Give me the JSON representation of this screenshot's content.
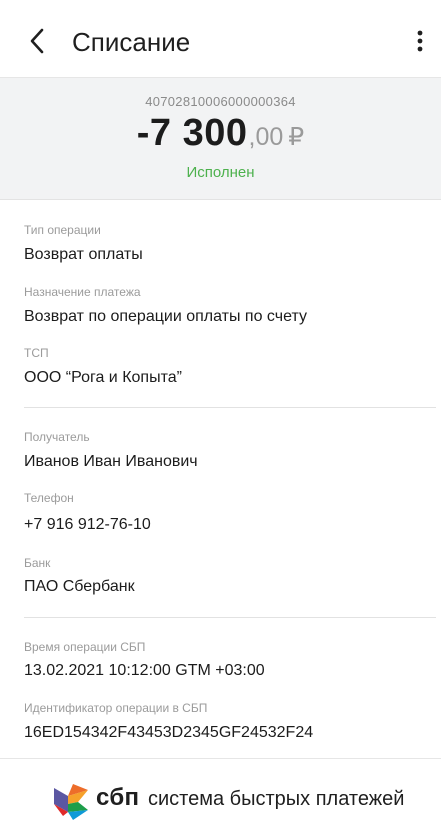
{
  "appbar": {
    "title": "Списание",
    "back_icon": "chevron-left-icon",
    "menu_icon": "more-vertical-icon"
  },
  "summary": {
    "account_number": "40702810006000000364",
    "amount_integer": "-7 300",
    "amount_fraction": ",00",
    "currency": "₽",
    "status": "Исполнен",
    "status_color": "#4db14d"
  },
  "details": {
    "operation_type": {
      "label": "Тип операции",
      "value": "Возврат оплаты"
    },
    "purpose": {
      "label": "Назначение платежа",
      "value": "Возврат по операции оплаты по счету"
    },
    "merchant": {
      "label": "ТСП",
      "value": "ООО “Рога и Копыта”"
    },
    "recipient": {
      "label": "Получатель",
      "value": "Иванов Иван Иванович"
    },
    "phone": {
      "label": "Телефон",
      "value": "+7 916 912-76-10"
    },
    "bank": {
      "label": "Банк",
      "value": "ПАО Сбербанк"
    },
    "sbp_time": {
      "label": "Время операции СБП",
      "value": "13.02.2021 10:12:00 GTM +03:00"
    },
    "sbp_id": {
      "label": "Идентификатор операции в СБП",
      "value": "16ED154342F43453D2345GF24532F24"
    }
  },
  "footer": {
    "logo_icon": "sbp-logo-icon",
    "logo_word": "сбп",
    "tagline": "система быстрых платежей"
  }
}
